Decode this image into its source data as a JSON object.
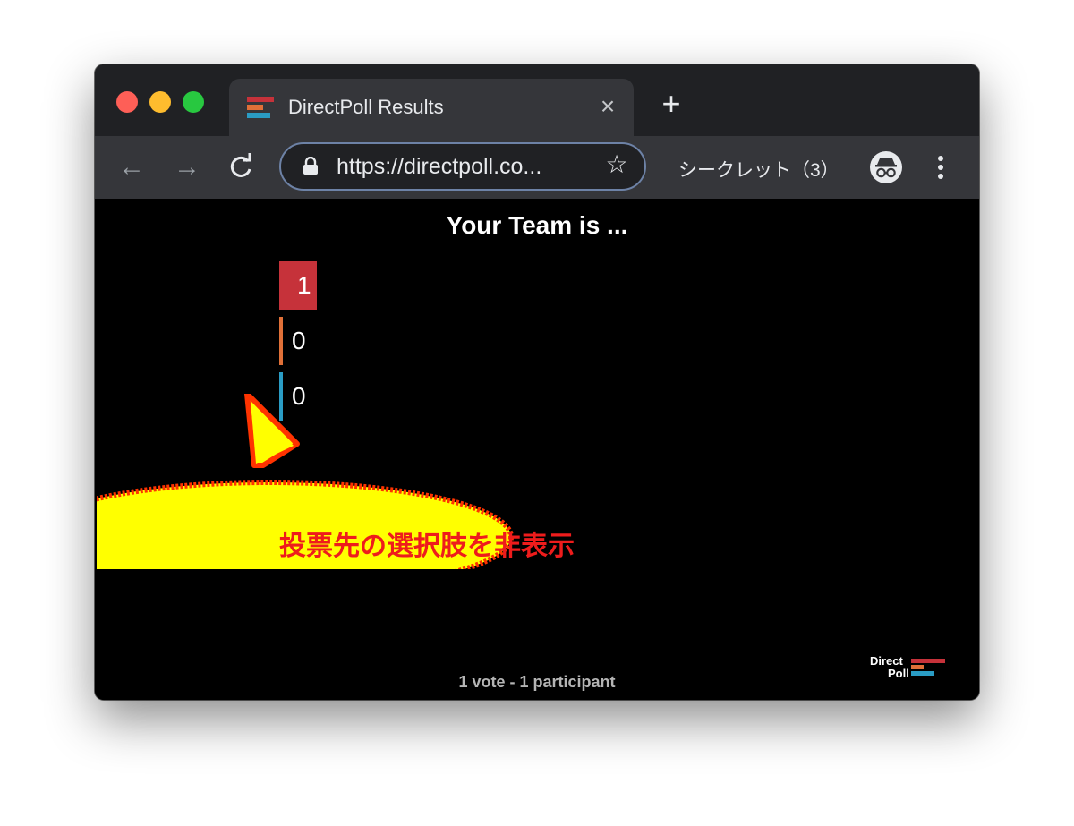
{
  "tab": {
    "title": "DirectPoll Results"
  },
  "address_bar": {
    "url": "https://directpoll.co..."
  },
  "incognito": {
    "label": "シークレット（3）"
  },
  "poll": {
    "title": "Your Team is ...",
    "options": [
      {
        "value": "1",
        "color": "#c6323a",
        "share": 1.0
      },
      {
        "value": "0",
        "color": "#e07038",
        "share": 0.0
      },
      {
        "value": "0",
        "color": "#2a9cc4",
        "share": 0.0
      }
    ],
    "stats": "1 vote - 1 participant"
  },
  "brand": {
    "line1": "Direct",
    "line2": "Poll"
  },
  "annotation": {
    "text": "投票先の選択肢を非表示"
  },
  "colors": {
    "tab_strip": "#202124",
    "toolbar": "#35363a",
    "brand_red": "#c6323a",
    "brand_orange": "#e07038",
    "brand_blue": "#2a9cc4",
    "bubble_fill": "#ffff00",
    "bubble_outline": "#ff3300",
    "annotation_text": "#ee1c1c"
  }
}
